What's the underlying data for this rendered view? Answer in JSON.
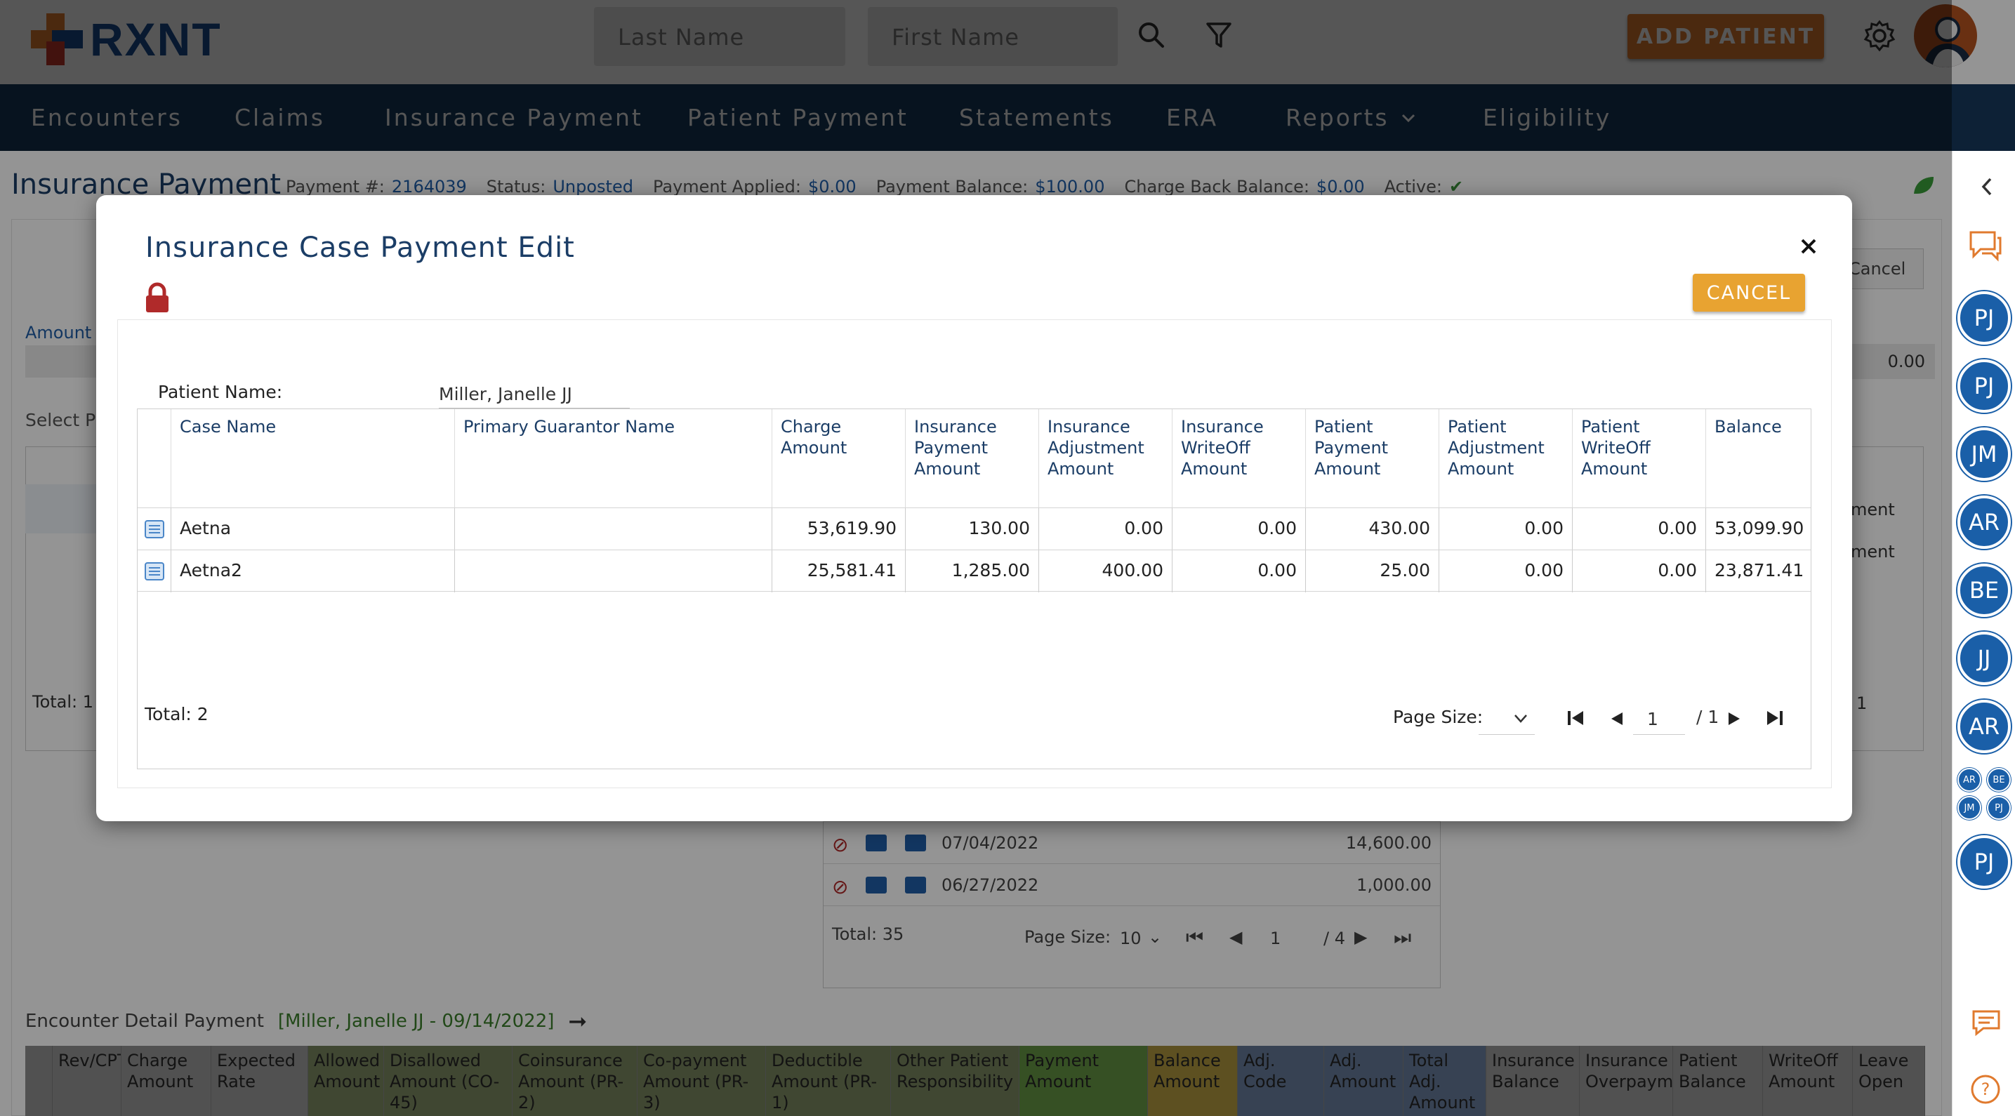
{
  "header": {
    "brand": "RXNT",
    "last_name_placeholder": "Last Name",
    "first_name_placeholder": "First Name",
    "add_patient_label": "ADD PATIENT"
  },
  "nav": {
    "items": [
      {
        "label": "Encounters"
      },
      {
        "label": "Claims"
      },
      {
        "label": "Insurance Payment"
      },
      {
        "label": "Patient Payment"
      },
      {
        "label": "Statements"
      },
      {
        "label": "ERA"
      },
      {
        "label": "Reports"
      },
      {
        "label": "Eligibility"
      }
    ]
  },
  "page": {
    "title": "Insurance Payment",
    "payment_label": "Payment #:",
    "payment_value": "2164039",
    "status_label": "Status:",
    "status_value": "Unposted",
    "applied_label": "Payment Applied:",
    "applied_value": "$0.00",
    "balance_label": "Payment Balance:",
    "balance_value": "$100.00",
    "chargeback_label": "Charge Back Balance:",
    "chargeback_value": "$0.00",
    "active_label": "Active:",
    "amount_label": "Amount",
    "select_label": "Select P",
    "bg_cancel": "Cancel",
    "bg_zero": "0.00",
    "bg_ment1": "ment",
    "bg_ment2": "ment",
    "bg_total": "Total: 1",
    "bg_pager_num": "1"
  },
  "modal": {
    "title": "Insurance Case Payment Edit",
    "cancel_label": "CANCEL",
    "patient_name_label": "Patient Name:",
    "patient_name_value": "Miller, Janelle JJ",
    "columns": [
      "Case Name",
      "Primary Guarantor Name",
      "Charge Amount",
      "Insurance Payment Amount",
      "Insurance Adjustment Amount",
      "Insurance WriteOff Amount",
      "Patient Payment Amount",
      "Patient Adjustment Amount",
      "Patient WriteOff Amount",
      "Balance"
    ],
    "rows": [
      {
        "case": "Aetna",
        "guarantor": "",
        "charge": "53,619.90",
        "ins_pay": "130.00",
        "ins_adj": "0.00",
        "ins_wo": "0.00",
        "pat_pay": "430.00",
        "pat_adj": "0.00",
        "pat_wo": "0.00",
        "balance": "53,099.90"
      },
      {
        "case": "Aetna2",
        "guarantor": "",
        "charge": "25,581.41",
        "ins_pay": "1,285.00",
        "ins_adj": "400.00",
        "ins_wo": "0.00",
        "pat_pay": "25.00",
        "pat_adj": "0.00",
        "pat_wo": "0.00",
        "balance": "23,871.41"
      }
    ],
    "total": "Total: 2",
    "page_size_label": "Page Size:",
    "page_current": "1",
    "page_total": "/ 1"
  },
  "encounters_table": {
    "rows": [
      {
        "date": "07/04/2022",
        "amount": "14,600.00"
      },
      {
        "date": "06/27/2022",
        "amount": "1,000.00"
      }
    ],
    "total": "Total: 35",
    "page_size_label": "Page Size:",
    "page_size_value": "10",
    "page_current": "1",
    "page_total": "/ 4"
  },
  "encounter_detail": {
    "label": "Encounter Detail Payment",
    "patient_link": "[Miller, Janelle JJ - 09/14/2022]",
    "columns": [
      {
        "label": "Rev/CPT",
        "bg": "#8c8c8c"
      },
      {
        "label": "Charge Amount",
        "bg": "#8c8c8c"
      },
      {
        "label": "Expected Rate",
        "bg": "#8c8c8c"
      },
      {
        "label": "Allowed Amount",
        "bg": "#6f7b56"
      },
      {
        "label": "Disallowed Amount (CO-45)",
        "bg": "#6f7b56"
      },
      {
        "label": "Coinsurance Amount (PR-2)",
        "bg": "#6f7b56"
      },
      {
        "label": "Co-payment Amount (PR-3)",
        "bg": "#6f7b56"
      },
      {
        "label": "Deductible Amount (PR-1)",
        "bg": "#6f7b56"
      },
      {
        "label": "Other Patient Responsibility",
        "bg": "#6f7b56"
      },
      {
        "label": "Payment Amount",
        "bg": "#5e8a3e"
      },
      {
        "label": "Balance Amount",
        "bg": "#a08a3a"
      },
      {
        "label": "Adj. Code",
        "bg": "#5f7390"
      },
      {
        "label": "Adj. Amount",
        "bg": "#5f7390"
      },
      {
        "label": "Total Adj. Amount",
        "bg": "#5f7390"
      },
      {
        "label": "Insurance Balance",
        "bg": "#8c8c8c"
      },
      {
        "label": "Insurance Overpaymen",
        "bg": "#8c8c8c"
      },
      {
        "label": "Patient Balance",
        "bg": "#8c8c8c"
      },
      {
        "label": "WriteOff Amount",
        "bg": "#8c8c8c"
      },
      {
        "label": "Leave Open",
        "bg": "#8c8c8c"
      }
    ]
  },
  "sidebar": {
    "avatars": [
      "PJ",
      "PJ",
      "JM",
      "AR",
      "BE",
      "JJ",
      "AR"
    ],
    "mini_avatars": [
      "AR",
      "BE",
      "JM",
      "PJ"
    ],
    "last_avatar": "PJ"
  },
  "colors": {
    "brand": "#1a4d8f",
    "nav_bg": "#173a5e",
    "accent_orange": "#e07a2e",
    "cancel_gold": "#e8a331",
    "lock_red": "#b02a2a",
    "link_blue": "#1f5ea8"
  }
}
